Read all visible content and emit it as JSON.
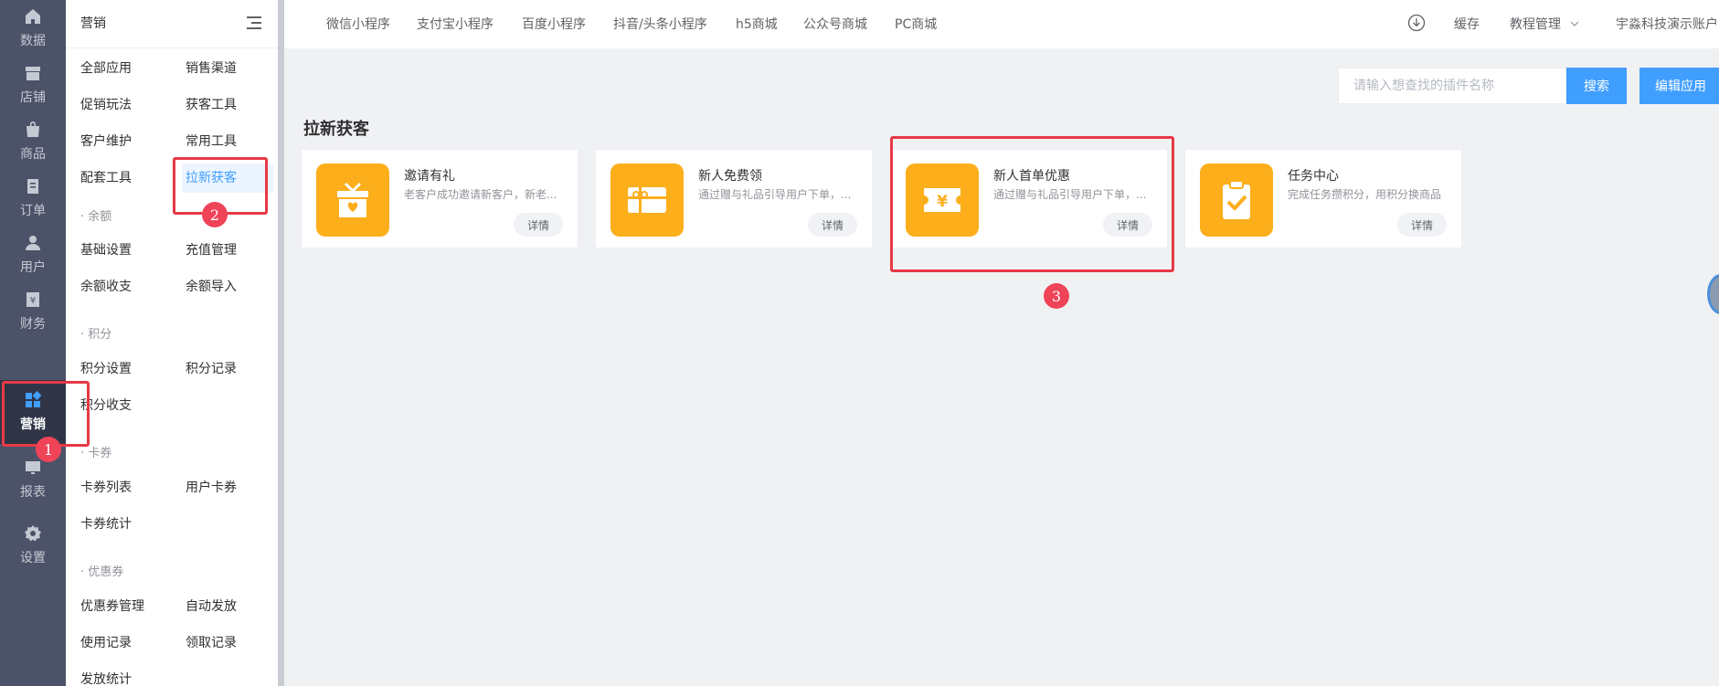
{
  "rail": {
    "items": [
      {
        "label": "数据",
        "icon": "home-icon"
      },
      {
        "label": "店铺",
        "icon": "store-icon"
      },
      {
        "label": "商品",
        "icon": "bag-icon"
      },
      {
        "label": "订单",
        "icon": "order-icon"
      },
      {
        "label": "用户",
        "icon": "user-icon"
      },
      {
        "label": "财务",
        "icon": "finance-icon"
      },
      {
        "label": "营销",
        "icon": "apps-icon",
        "active": true
      },
      {
        "label": "报表",
        "icon": "report-icon"
      },
      {
        "label": "设置",
        "icon": "gear-icon"
      }
    ]
  },
  "submenu": {
    "title": "营销",
    "items": {
      "all_apps": "全部应用",
      "sales_channel": "销售渠道",
      "promo": "促销玩法",
      "acquisition_tools": "获客工具",
      "retention": "客户维护",
      "common_tools": "常用工具",
      "support_tools": "配套工具",
      "new_customer": "拉新获客",
      "balance_group": "· 余额",
      "base_settings": "基础设置",
      "recharge": "充值管理",
      "balance_flow": "余额收支",
      "balance_import": "余额导入",
      "points_group": "· 积分",
      "points_settings": "积分设置",
      "points_records": "积分记录",
      "points_flow": "积分收支",
      "cards_group": "· 卡券",
      "card_list": "卡券列表",
      "user_cards": "用户卡券",
      "card_stats": "卡券统计",
      "coupon_group": "· 优惠券",
      "coupon_manage": "优惠券管理",
      "auto_issue": "自动发放",
      "usage_records": "使用记录",
      "claim_records": "领取记录",
      "issue_stats": "发放统计"
    }
  },
  "topbar": {
    "tabs": [
      "微信小程序",
      "支付宝小程序",
      "百度小程序",
      "抖音/头条小程序",
      "h5商城",
      "公众号商城",
      "PC商城"
    ],
    "cache": "缓存",
    "tutorial": "教程管理",
    "account": "宇淼科技演示账户"
  },
  "search": {
    "placeholder": "请输入想查找的插件名称",
    "search_label": "搜索",
    "edit_label": "编辑应用"
  },
  "section": {
    "title": "拉新获客",
    "cards": [
      {
        "title": "邀请有礼",
        "desc": "老客户成功邀请新客户，新老...",
        "button": "详情",
        "icon": "gift-icon"
      },
      {
        "title": "新人免费领",
        "desc": "通过赠与礼品引导用户下单，...",
        "button": "详情",
        "icon": "giftcard-icon"
      },
      {
        "title": "新人首单优惠",
        "desc": "通过赠与礼品引导用户下单，...",
        "button": "详情",
        "icon": "yen-ticket-icon"
      },
      {
        "title": "任务中心",
        "desc": "完成任务攒积分，用积分换商品",
        "button": "详情",
        "icon": "clipboard-check-icon"
      }
    ]
  },
  "annotations": [
    "1",
    "2",
    "3"
  ],
  "colors": {
    "primary": "#409eff",
    "card_icon": "#fcae1b",
    "highlight": "#e63946",
    "badge": "#ef4358",
    "rail": "#4c5368"
  }
}
